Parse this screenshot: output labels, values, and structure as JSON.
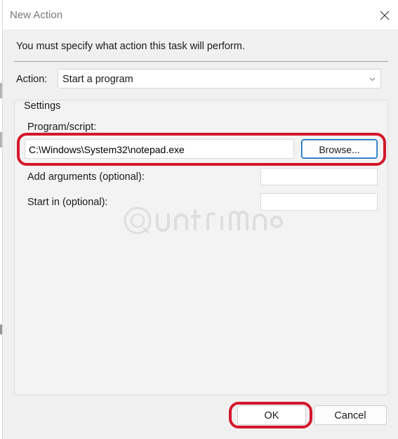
{
  "window": {
    "title": "New Action"
  },
  "instruction": "You must specify what action this task will perform.",
  "action": {
    "label": "Action:",
    "selected": "Start a program"
  },
  "settings": {
    "title": "Settings",
    "program_label": "Program/script:",
    "program_value": "C:\\Windows\\System32\\notepad.exe",
    "browse_label": "Browse...",
    "arguments_label": "Add arguments (optional):",
    "arguments_value": "",
    "start_in_label": "Start in (optional):",
    "start_in_value": ""
  },
  "buttons": {
    "ok_label": "OK",
    "cancel_label": "Cancel"
  },
  "colors": {
    "highlight": "#d4172a",
    "accent_border": "#0f6cbd",
    "dialog_background": "#f0f0f0"
  },
  "icons": {
    "close": "close-icon",
    "dropdown": "chevron-down-icon",
    "watermark": "quantrimang-watermark-logo"
  }
}
